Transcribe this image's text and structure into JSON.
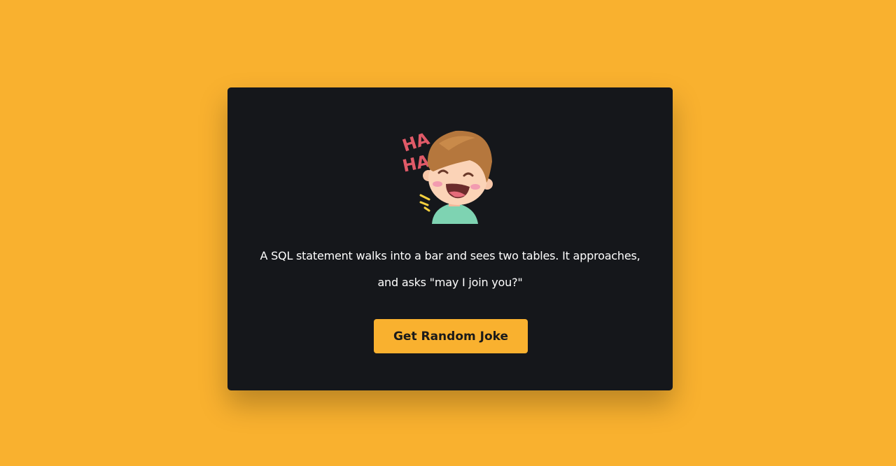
{
  "colors": {
    "background": "#f9b12f",
    "card": "#15171b",
    "button_bg": "#f9b12f",
    "button_text": "#1a1a1a",
    "joke_text": "#ffffff"
  },
  "card": {
    "emoji": {
      "icon": "laughing-boy-icon",
      "text_top": "HA",
      "text_bottom": "HA"
    },
    "joke_line1": "A SQL statement walks into a bar and sees two tables. It approaches,",
    "joke_line2": "and asks \"may I join you?\"",
    "button_label": "Get Random Joke"
  }
}
